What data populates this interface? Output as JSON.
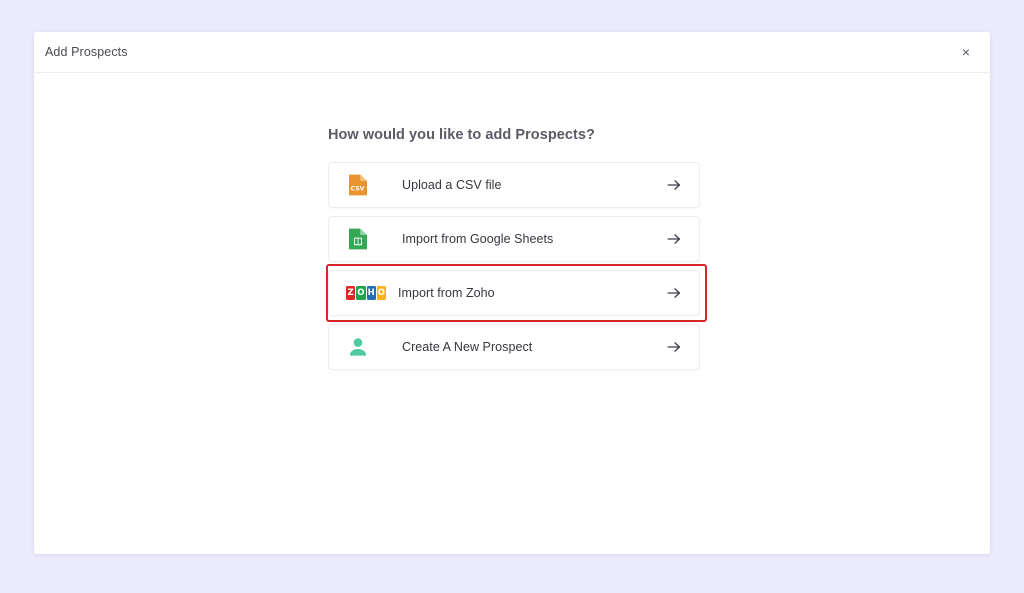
{
  "page": {
    "background_color": "#ecebfb"
  },
  "modal": {
    "title": "Add Prospects",
    "close_label": "×",
    "close_icon": "close-icon",
    "heading": "How would you like to add Prospects?",
    "options": [
      {
        "label": "Upload a CSV file",
        "icon": "csv-file-icon",
        "icon_badge_text": "CSV",
        "icon_color": "#e8952f",
        "arrow_icon": "arrow-right-icon",
        "highlighted": false
      },
      {
        "label": "Import from Google Sheets",
        "icon": "google-sheets-icon",
        "icon_color": "#34a853",
        "arrow_icon": "arrow-right-icon",
        "highlighted": false
      },
      {
        "label": "Import from Zoho",
        "icon": "zoho-logo-icon",
        "icon_letters": [
          "Z",
          "O",
          "H",
          "O"
        ],
        "icon_colors": [
          "#e42527",
          "#25a24a",
          "#226db4",
          "#f9b21d"
        ],
        "arrow_icon": "arrow-right-icon",
        "highlighted": true,
        "highlight_color": "#d8232a"
      },
      {
        "label": "Create A New Prospect",
        "icon": "person-icon",
        "icon_color": "#4ec9a2",
        "arrow_icon": "arrow-right-icon",
        "highlighted": false
      }
    ]
  }
}
